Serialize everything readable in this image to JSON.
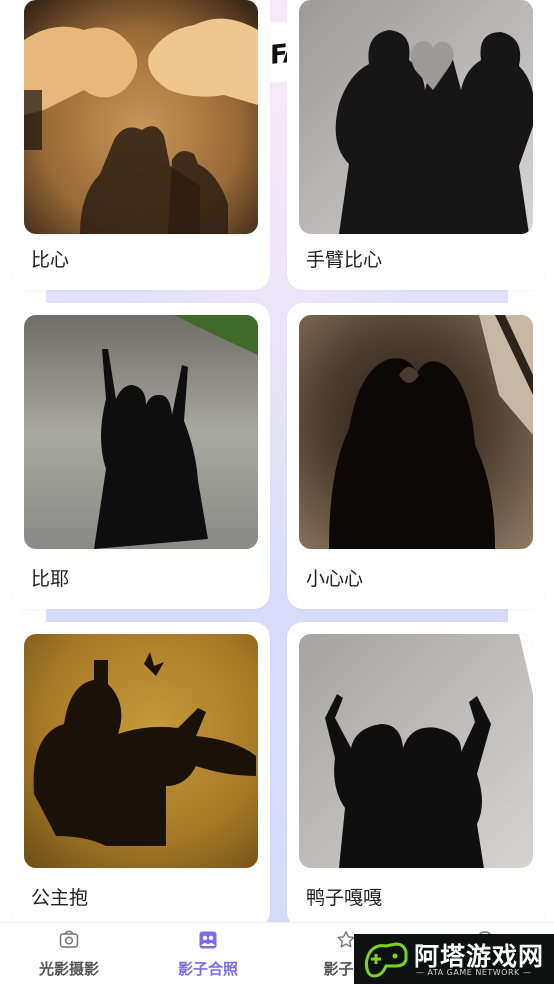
{
  "cards": [
    {
      "label": "比心",
      "icon": "photo-heart-hands"
    },
    {
      "label": "手臂比心",
      "icon": "photo-arm-heart"
    },
    {
      "label": "比耶",
      "icon": "photo-peace-sign"
    },
    {
      "label": "小心心",
      "icon": "photo-small-heart"
    },
    {
      "label": "公主抱",
      "icon": "photo-princess-carry"
    },
    {
      "label": "鸭子嘎嘎",
      "icon": "photo-duck-pose"
    }
  ],
  "tabs": [
    {
      "label": "光影摄影",
      "icon": "camera-icon",
      "active": false
    },
    {
      "label": "影子合照",
      "icon": "portrait-icon",
      "active": true
    },
    {
      "label": "影子猜",
      "icon": "star-icon",
      "active": false
    },
    {
      "label": "",
      "icon": "profile-icon",
      "active": false
    }
  ],
  "colors": {
    "accent": "#7b6cf2",
    "tab_inactive": "#555555",
    "card_bg": "#ffffff"
  },
  "watermark": {
    "title": "阿塔游戏网",
    "subtitle": "— ATA GAME NETWORK —"
  }
}
